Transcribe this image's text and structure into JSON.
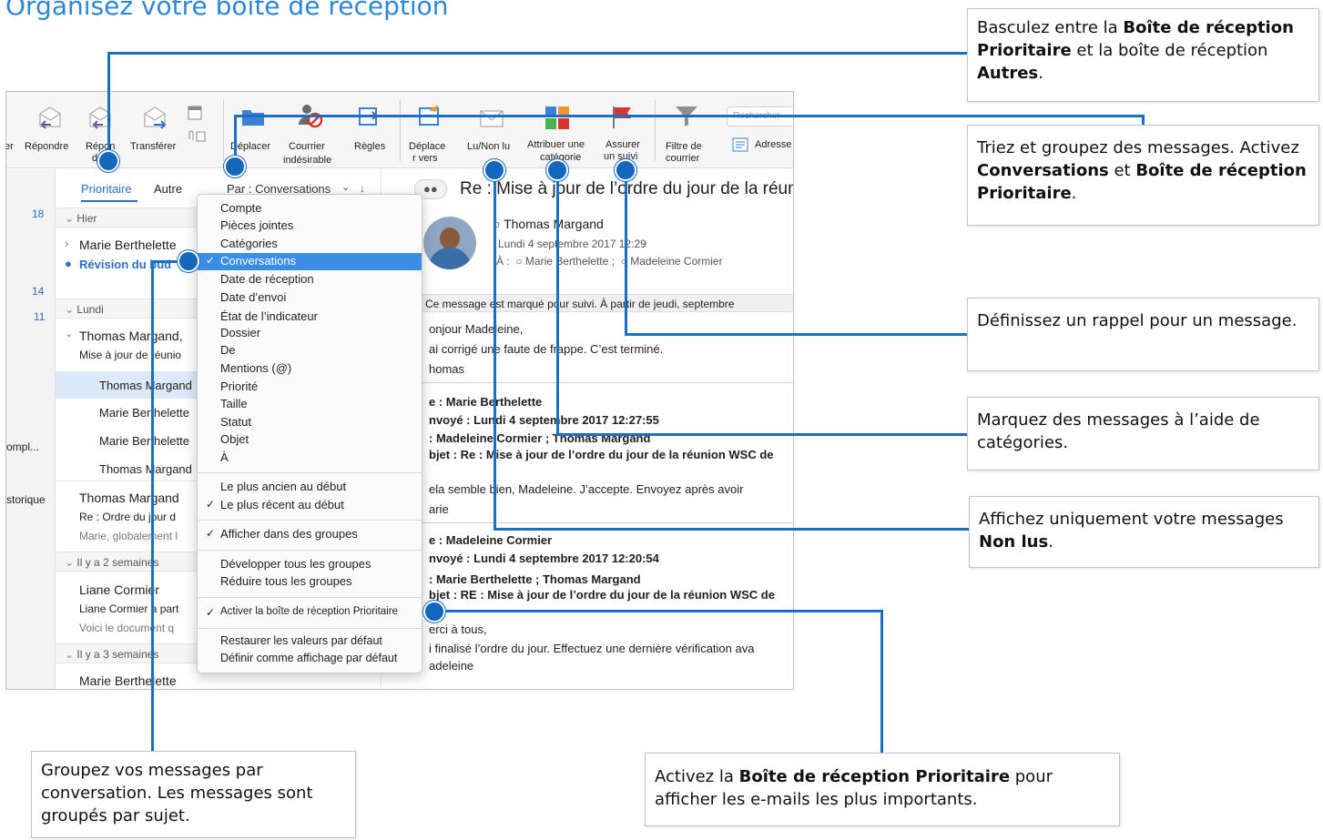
{
  "page_title": "Organisez votre boîte de réception",
  "ribbon": {
    "partial_left": "er",
    "reply": "Répondre",
    "reply_all_1": "Répon",
    "reply_all_2": "dr",
    "forward": "Transférer",
    "move": "Déplacer",
    "junk_1": "Courrier",
    "junk_2": "indésirable",
    "rules": "Règles",
    "move_to_1": "Déplace",
    "move_to_2": "r vers",
    "read_unread": "Lu/Non lu",
    "categorize_1": "Attribuer une",
    "categorize_2": "catégorie",
    "follow_up_1": "Assurer",
    "follow_up_2": "un suivi",
    "filter_1": "Filtre de",
    "filter_2": "courrier",
    "address": "Adresse",
    "search_placeholder": "Rechercher"
  },
  "left_col": {
    "count_18": "18",
    "count_14": "14",
    "count_11": "11",
    "partial_1": "ompl...",
    "partial_2": "storique"
  },
  "list": {
    "tab_focused": "Prioritaire",
    "tab_other": "Autre",
    "sort_label": "Par : Conversations",
    "group_yesterday": "Hier",
    "item1_sender": "Marie Berthelette",
    "item1_subject": "Révision du bud",
    "group_monday": "Lundi",
    "item2_sender": "Thomas Margand,",
    "item2_subject": "Mise à jour de réunio",
    "thread1": "Thomas Margand",
    "thread2": "Marie Berthelette",
    "thread3": "Marie Berthelette",
    "thread4": "Thomas Margand",
    "item3_sender": "Thomas Margand",
    "item3_subject": "Re : Ordre du jour d",
    "item3_preview": "Marie, globalement l",
    "group_2weeks": "Il y a 2 semaines",
    "item4_sender": "Liane Cormier",
    "item4_subject": "Liane Cormier a part",
    "item4_preview": "Voici le document q",
    "group_3weeks": "Il y a 3 semaines",
    "item5_sender": "Marie Berthelette"
  },
  "menu": {
    "items": [
      "Compte",
      "Pièces jointes",
      "Catégories",
      "Conversations",
      "Date de réception",
      "Date d’envoi",
      "État de l’indicateur",
      "Dossier",
      "De",
      "Mentions (@)",
      "Priorité",
      "Taille",
      "Statut",
      "Objet",
      "À"
    ],
    "oldest_first": "Le plus ancien au début",
    "newest_first": "Le plus récent au début",
    "show_groups": "Afficher dans des groupes",
    "expand_all": "Développer tous les groupes",
    "collapse_all": "Réduire tous les groupes",
    "enable_focused": "Activer la boîte de réception Prioritaire",
    "restore_defaults": "Restaurer les valeurs par défaut",
    "set_default": "Définir comme affichage par défaut"
  },
  "reading": {
    "subject": "Re : Mise à jour de l’ordre du jour de la réun",
    "sender": "Thomas Margand",
    "date": "Lundi 4 septembre 2017 12:29",
    "to_label": "À :",
    "to_1": "Marie Berthelette ;",
    "to_2": "Madeleine Cormier",
    "flag_banner": "Ce message est marqué pour suivi. À partir de jeudi, septembre",
    "body_1": "onjour Madeleine,",
    "body_2": "ai corrigé une faute de frappe. C’est terminé.",
    "body_3": "homas",
    "q1_from": "e : Marie Berthelette",
    "q1_sent": "nvoyé : Lundi 4 septembre 2017 12:27:55",
    "q1_to": ": Madeleine Cormier ; Thomas Margand",
    "q1_subj": "bjet : Re : Mise à jour de l’ordre du jour de la réunion WSC de",
    "q1_body": "ela semble bien, Madeleine. J’accepte. Envoyez après avoir",
    "q1_sign": "arie",
    "q2_from": "e : Madeleine Cormier",
    "q2_sent": "nvoyé : Lundi 4 septembre 2017 12:20:54",
    "q2_to": ": Marie Berthelette ; Thomas Margand",
    "q2_subj": "bjet : RE : Mise à jour de l’ordre du jour de la réunion WSC de",
    "q2_body_1": "erci à tous,",
    "q2_body_2": "i finalisé l’ordre du jour. Effectuez une dernière vérification ava",
    "q2_sign": "adeleine"
  },
  "callouts": {
    "focused": {
      "pre": "Basculez entre la ",
      "b1": "Boîte de réception Prioritaire",
      "mid": " et la boîte de réception ",
      "b2": "Autres",
      "post": "."
    },
    "sort": {
      "pre": "Triez et groupez des messages. Activez ",
      "b1": "Conversations",
      "mid": " et ",
      "b2": "Boîte de réception Prioritaire",
      "post": "."
    },
    "reminder": "Définissez un rappel pour un message.",
    "categories": "Marquez des messages à l’aide de catégories.",
    "unread": {
      "pre": "Affichez uniquement votre messages ",
      "b1": "Non lus",
      "post": "."
    },
    "group": "Groupez vos messages par conversation. Les messages sont groupés par sujet.",
    "enable": {
      "pre": "Activez la ",
      "b1": "Boîte de réception Prioritaire",
      "post": " pour afficher les e-mails les plus importants."
    }
  },
  "colors": {
    "accent": "#1467bd",
    "title": "#2e87d6",
    "selection": "#3a8ee6",
    "flag": "#d9342b"
  }
}
